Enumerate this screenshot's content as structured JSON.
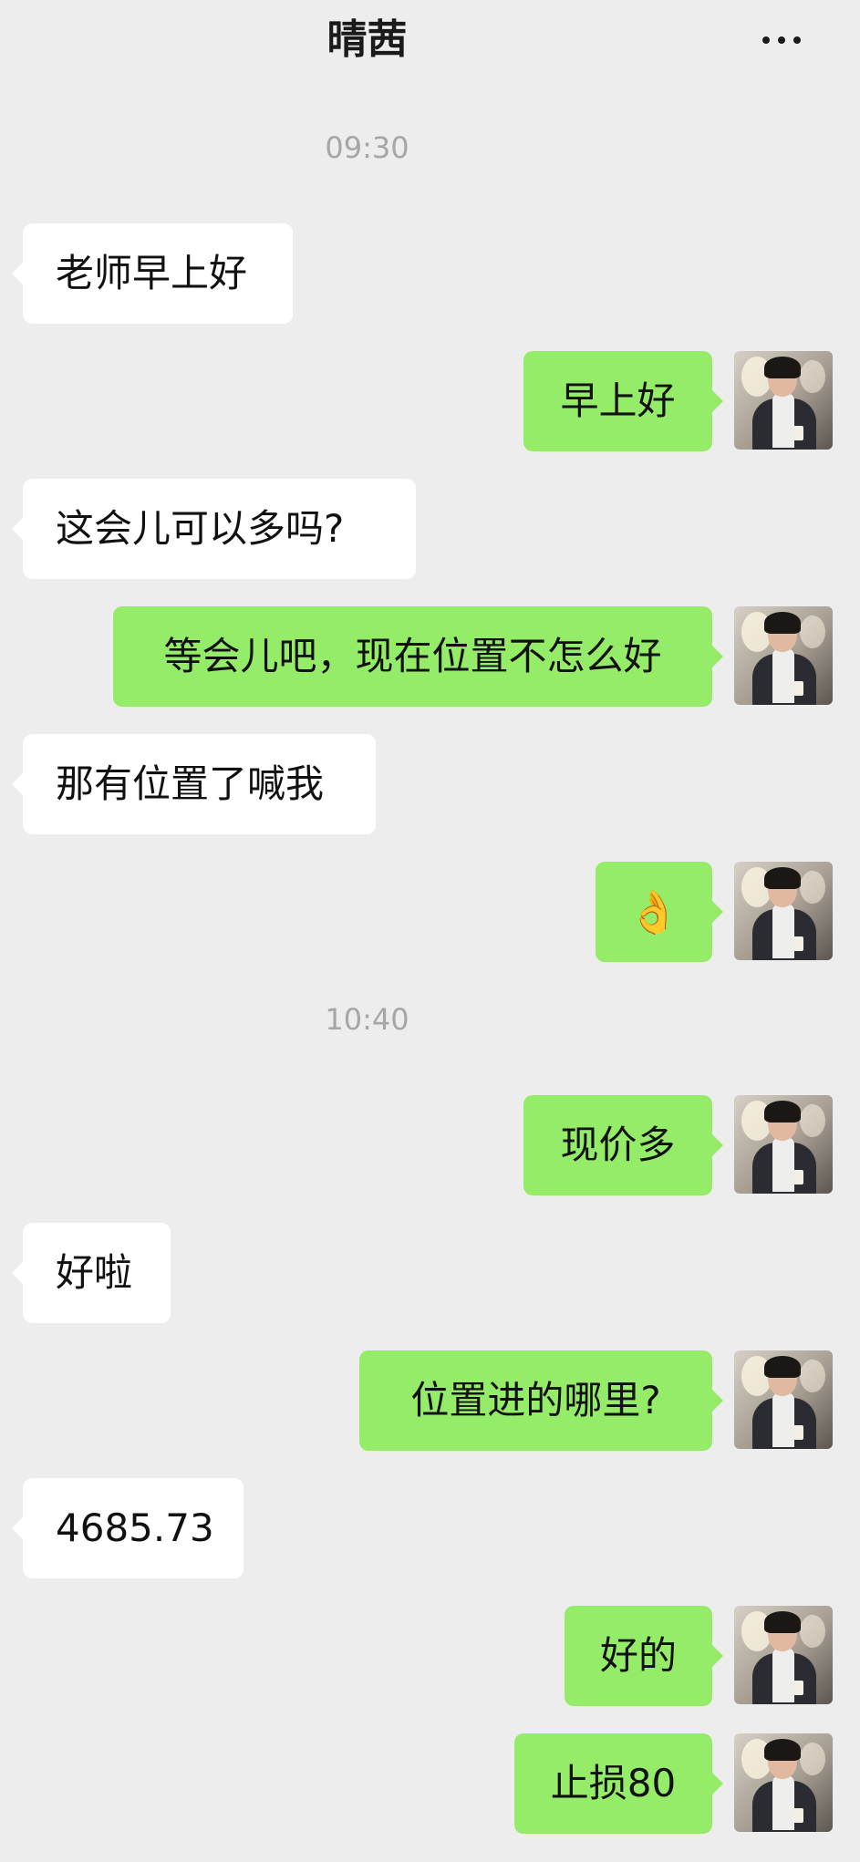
{
  "header": {
    "title": "晴茜",
    "more_icon": "more-horizontal-icon"
  },
  "times": [
    "09:30",
    "10:40"
  ],
  "messages": [
    {
      "side": "in",
      "text": "老师早上好"
    },
    {
      "side": "out",
      "text": "早上好"
    },
    {
      "side": "in",
      "text": "这会儿可以多吗?"
    },
    {
      "side": "out",
      "text": "等会儿吧，现在位置不怎么好"
    },
    {
      "side": "in",
      "text": "那有位置了喊我"
    },
    {
      "side": "out",
      "text": "👌"
    },
    {
      "side": "out",
      "text": "现价多"
    },
    {
      "side": "in",
      "text": "好啦"
    },
    {
      "side": "out",
      "text": "位置进的哪里?"
    },
    {
      "side": "in",
      "text": "4685.73"
    },
    {
      "side": "out",
      "text": "好的"
    },
    {
      "side": "out",
      "text": "止损80"
    }
  ],
  "colors": {
    "background": "#ededed",
    "outgoing_bubble": "#95ec69",
    "incoming_bubble": "#ffffff"
  }
}
